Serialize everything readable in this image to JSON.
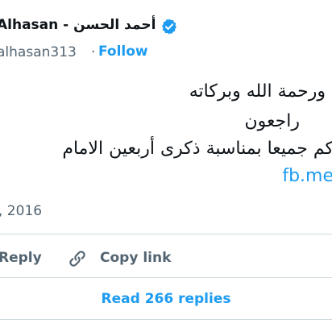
{
  "header": {
    "display_name": "Alhasan - أحمد الحسن",
    "handle": "alhasan313",
    "handle_separator": "·",
    "follow_label": "Follow"
  },
  "tweet": {
    "lines": [
      "ورحمة الله وبركاته",
      "راجعون",
      "كم جميعا بمناسبة ذكرى أربعين الامام"
    ],
    "link_text": "fb.me",
    "timestamp": ", 2016"
  },
  "actions": {
    "reply_label": "Reply",
    "copy_link_label": "Copy link",
    "read_replies_label": "Read 266 replies"
  },
  "colors": {
    "accent": "#1d9bf0",
    "secondary_text": "#536471",
    "divider": "#cfd9de"
  },
  "icons": {
    "verified": "verified-badge-icon",
    "copy_link": "link-icon"
  }
}
